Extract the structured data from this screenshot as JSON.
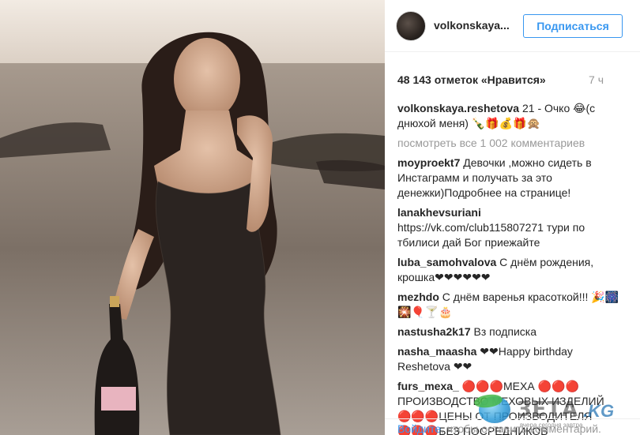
{
  "post": {
    "username": "volkonskaya...",
    "follow_label": "Подписаться",
    "likes": "48 143 отметок «Нравится»",
    "time": "7 ч"
  },
  "comments": {
    "caption": {
      "user": "volkonskaya.reshetova",
      "text": "21 - Очко 😂(с днюхой меня) 🍾🎁💰🎁🙊"
    },
    "view_all": "посмотреть все 1 002 комментариев",
    "items": [
      {
        "user": "moyproekt7",
        "text": "Девочки ,можно сидеть в Инстаграмм и получать за это денежки)Подробнее на странице!"
      },
      {
        "user": "lanakhevsuriani",
        "text": "https://vk.com/club115807271 тури по тбилиси дай Бог приежайте"
      },
      {
        "user": "luba_samohvalova",
        "text": "С днём рождения, крошка❤❤❤❤❤❤"
      },
      {
        "user": "mezhdo",
        "text": "С днём варенья красоткой!!! 🎉🎆🎇🎈🍸🎂"
      },
      {
        "user": "nastusha2k17",
        "text": "Вз подписка"
      },
      {
        "user": "nasha_maasha",
        "text": "❤❤Happy birthday Reshetova ❤❤"
      },
      {
        "user": "furs_mexa_",
        "text": "🔴🔴🔴МЕХА 🔴🔴🔴 ПРОИЗВОДСТВО МЕХОВЫХ ИЗДЕЛИЙ 🔴🔴🔴ЦЕНЫ ОТ ПРОИЗВОДИТЕЛЯ 🔴🔴🔴БЕЗ ПОСРЕДНИКОВ"
      }
    ]
  },
  "add_comment": {
    "link": "Войдите",
    "text": ", чтобы оставить комментарий."
  },
  "watermark": {
    "brand": "ЗЕТА",
    "domain": ".KG",
    "tagline": "вчера сегодня завтра"
  },
  "colors": {
    "accent": "#3897f0",
    "muted": "#999999",
    "text": "#262626"
  }
}
